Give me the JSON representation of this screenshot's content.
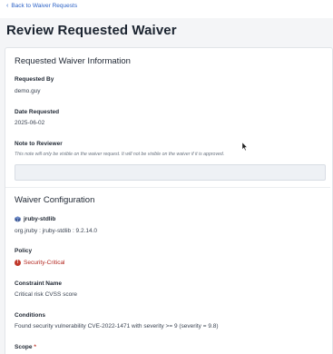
{
  "nav": {
    "back_label": "Back to Waiver Requests"
  },
  "page": {
    "title": "Review Requested Waiver"
  },
  "waiver_info": {
    "section_title": "Requested Waiver Information",
    "requested_by_label": "Requested By",
    "requested_by_value": "demo.guy",
    "date_label": "Date Requested",
    "date_value": "2025-06-02",
    "note_label": "Note to Reviewer",
    "note_hint": "This note will only be visible on the waiver request. It will not be visible on the waiver if it is approved.",
    "note_value": ""
  },
  "waiver_config": {
    "section_title": "Waiver Configuration",
    "component_name": "jruby-stdlib",
    "component_icon": "package-icon",
    "component_coordinates": "org.jruby : jruby-stdlib : 9.2.14.0",
    "policy_label": "Policy",
    "policy_icon": "alert-icon",
    "policy_value": "Security-Critical",
    "constraint_label": "Constraint Name",
    "constraint_value": "Critical risk CVSS score",
    "conditions_label": "Conditions",
    "conditions_value": "Found security vulnerability CVE-2022-1471 with severity >= 9 (severity = 9.8)",
    "scope_label": "Scope",
    "scope_required_marker": "*"
  },
  "colors": {
    "link": "#2c62c6",
    "danger": "#b3261e",
    "background": "#f4f5f7",
    "card": "#ffffff"
  }
}
